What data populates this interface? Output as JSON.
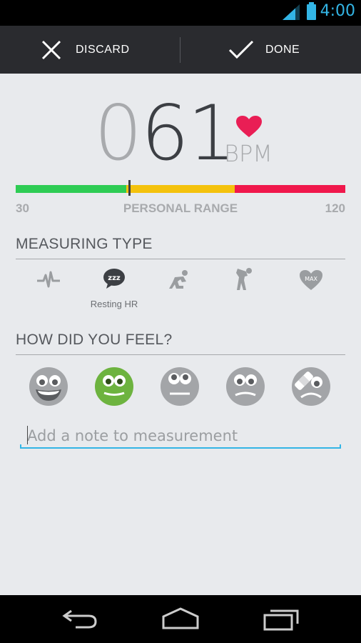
{
  "status_bar": {
    "time": "4:00",
    "icons": [
      "signal-icon",
      "battery-icon"
    ],
    "accent": "#33b5e5"
  },
  "action_bar": {
    "discard_label": "DISCARD",
    "done_label": "DONE",
    "discard_icon": "close-icon",
    "done_icon": "check-icon"
  },
  "measurement": {
    "bpm_lead": "0",
    "bpm_digits": "61",
    "unit": "BPM",
    "heart_color": "#e91e55"
  },
  "range": {
    "min": "30",
    "max": "120",
    "label": "PERSONAL RANGE",
    "segments": [
      {
        "color": "#2ecc54",
        "fraction": 0.335
      },
      {
        "color": "#f4c20d",
        "fraction": 0.33
      },
      {
        "color": "#f0184c",
        "fraction": 0.335
      }
    ],
    "marker_value": 61
  },
  "measuring_type": {
    "title": "MEASURING TYPE",
    "types": [
      {
        "icon": "pulse-icon"
      },
      {
        "icon": "resting-zzz-icon",
        "label": "Resting HR",
        "selected": true
      },
      {
        "icon": "runner-start-icon"
      },
      {
        "icon": "runner-tired-icon"
      },
      {
        "icon": "max-heart-icon",
        "text": "MAX"
      }
    ]
  },
  "feeling": {
    "title": "HOW DID YOU FEEL?",
    "faces": [
      {
        "icon": "happy-face-icon"
      },
      {
        "icon": "smiling-face-icon",
        "selected": true,
        "color": "#6db33f"
      },
      {
        "icon": "neutral-face-icon"
      },
      {
        "icon": "sad-face-icon"
      },
      {
        "icon": "injured-face-icon"
      }
    ]
  },
  "note": {
    "placeholder": "Add a note to measurement",
    "value": ""
  },
  "nav_bar": {
    "icons": [
      "back-icon",
      "home-icon",
      "recent-apps-icon"
    ]
  }
}
